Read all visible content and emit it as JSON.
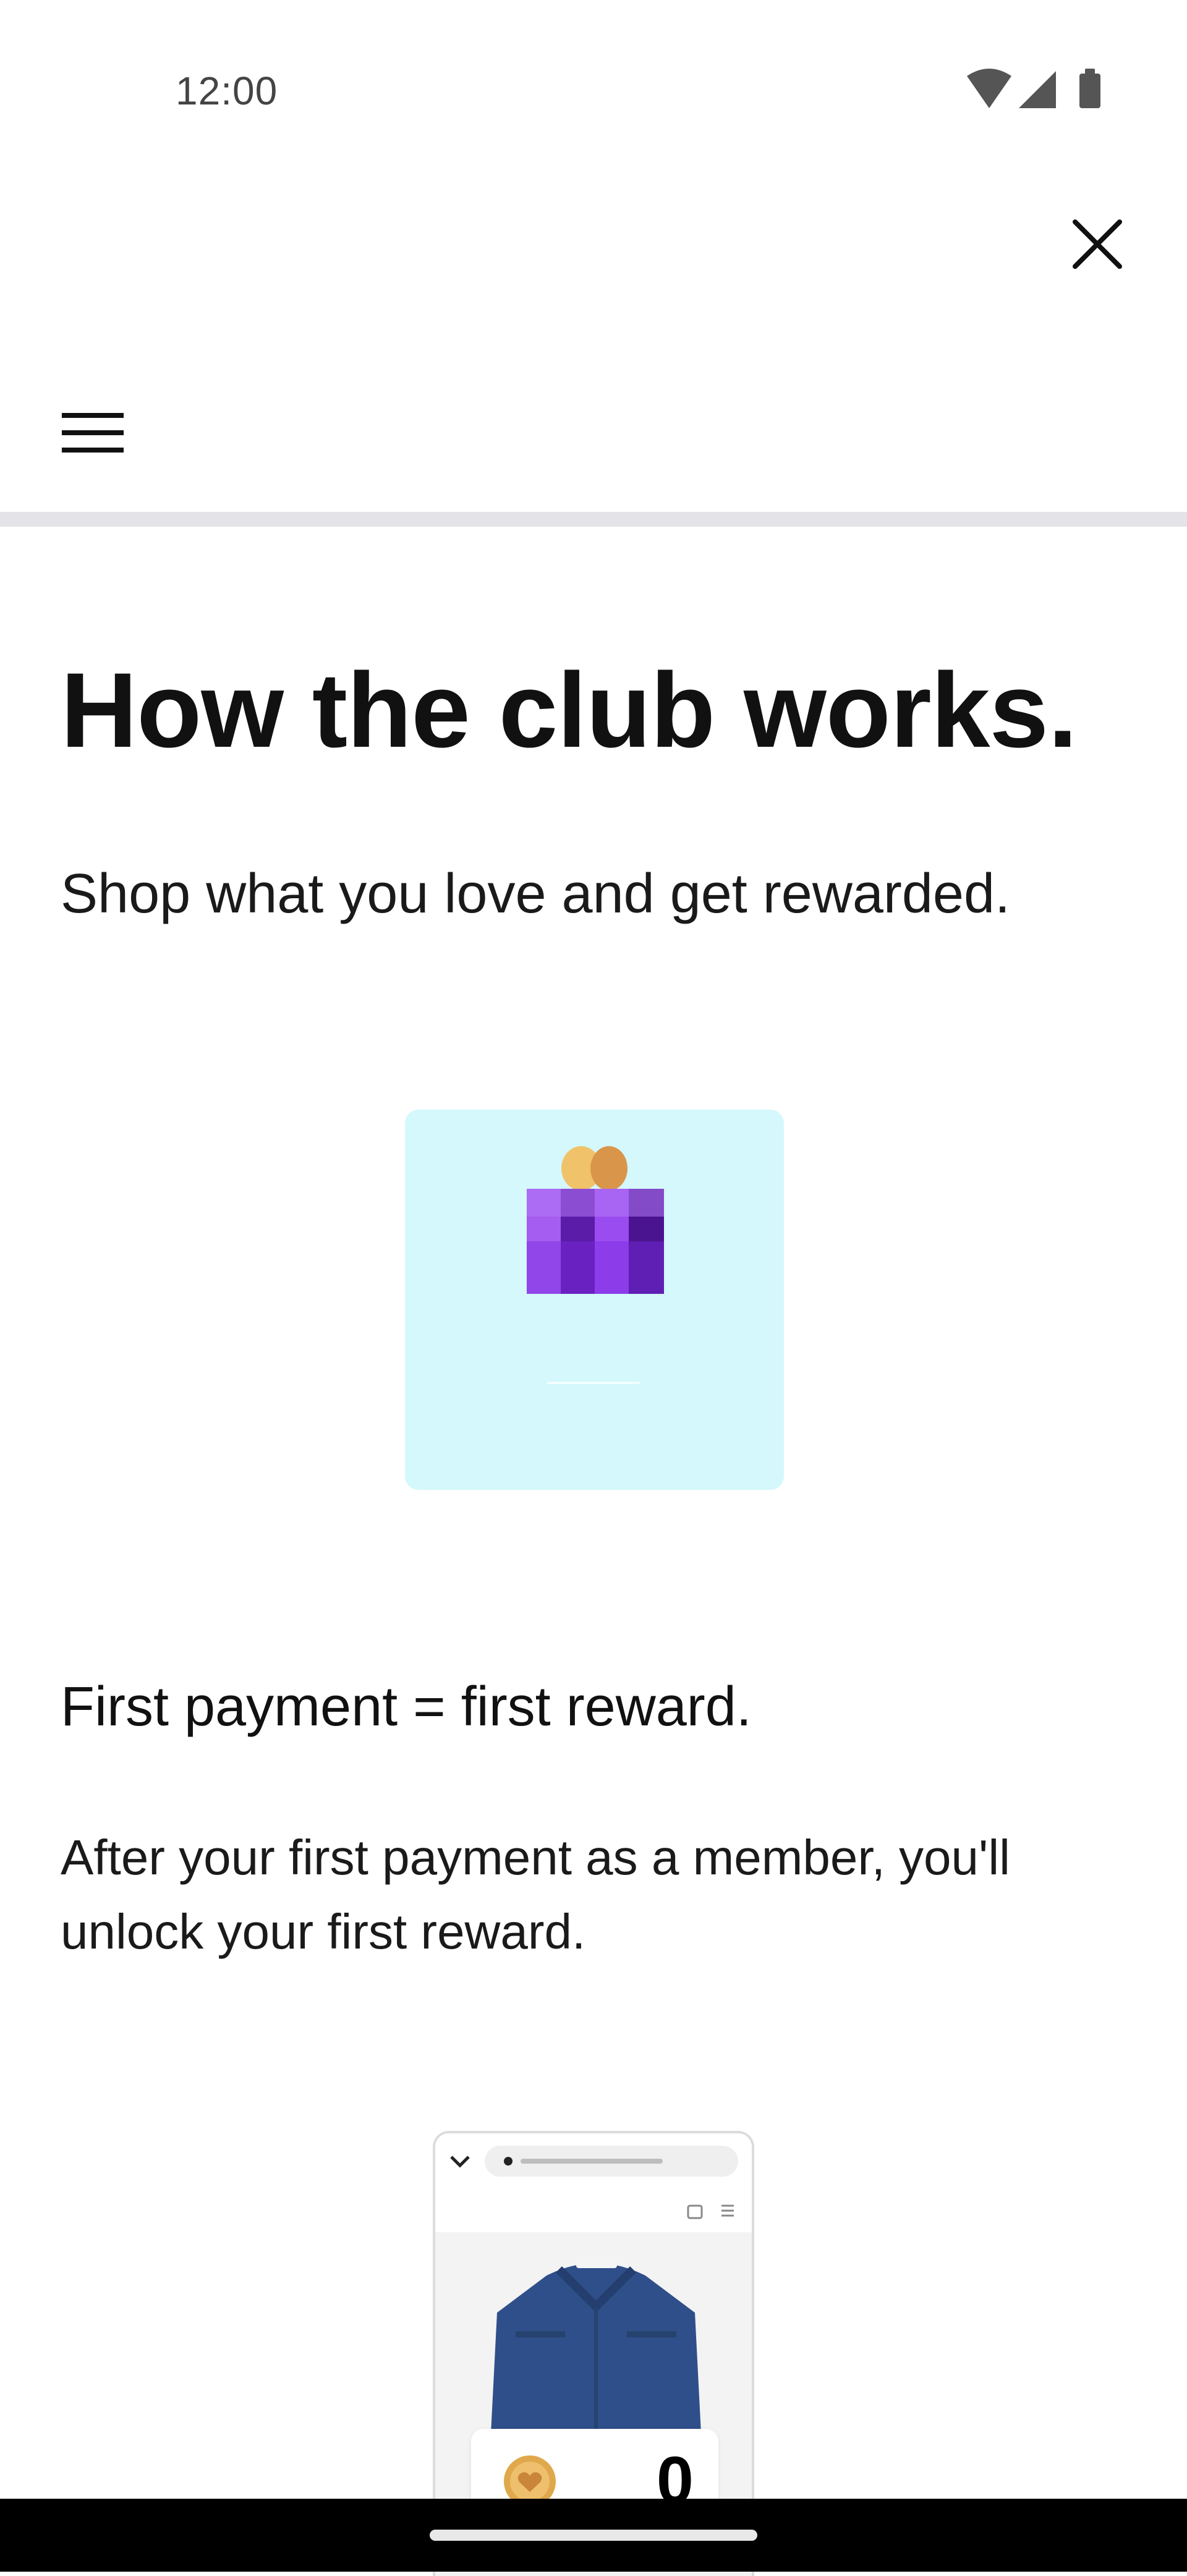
{
  "status_bar": {
    "time": "12:00",
    "icons": [
      "wifi-icon",
      "cellular-signal-icon",
      "battery-icon"
    ]
  },
  "header": {
    "close_icon": "close-icon",
    "menu_icon": "hamburger-menu-icon"
  },
  "hero": {
    "title": "How the club works.",
    "subtitle": "Shop what you love and get rewarded."
  },
  "step": {
    "illustration": "gift-box-illustration",
    "title": "First payment = first reward.",
    "body": "After your first payment as a member, you'll unlock your first reward."
  },
  "preview": {
    "illustration": "phone-mockup-jacket",
    "points": "0",
    "coin_icon": "heart-coin-icon"
  },
  "colors": {
    "gift_background": "#d4f8fb",
    "gift_purple": "#7b2be0",
    "ribbon_gold": "#e0a84c",
    "divider": "#e4e4e8"
  }
}
